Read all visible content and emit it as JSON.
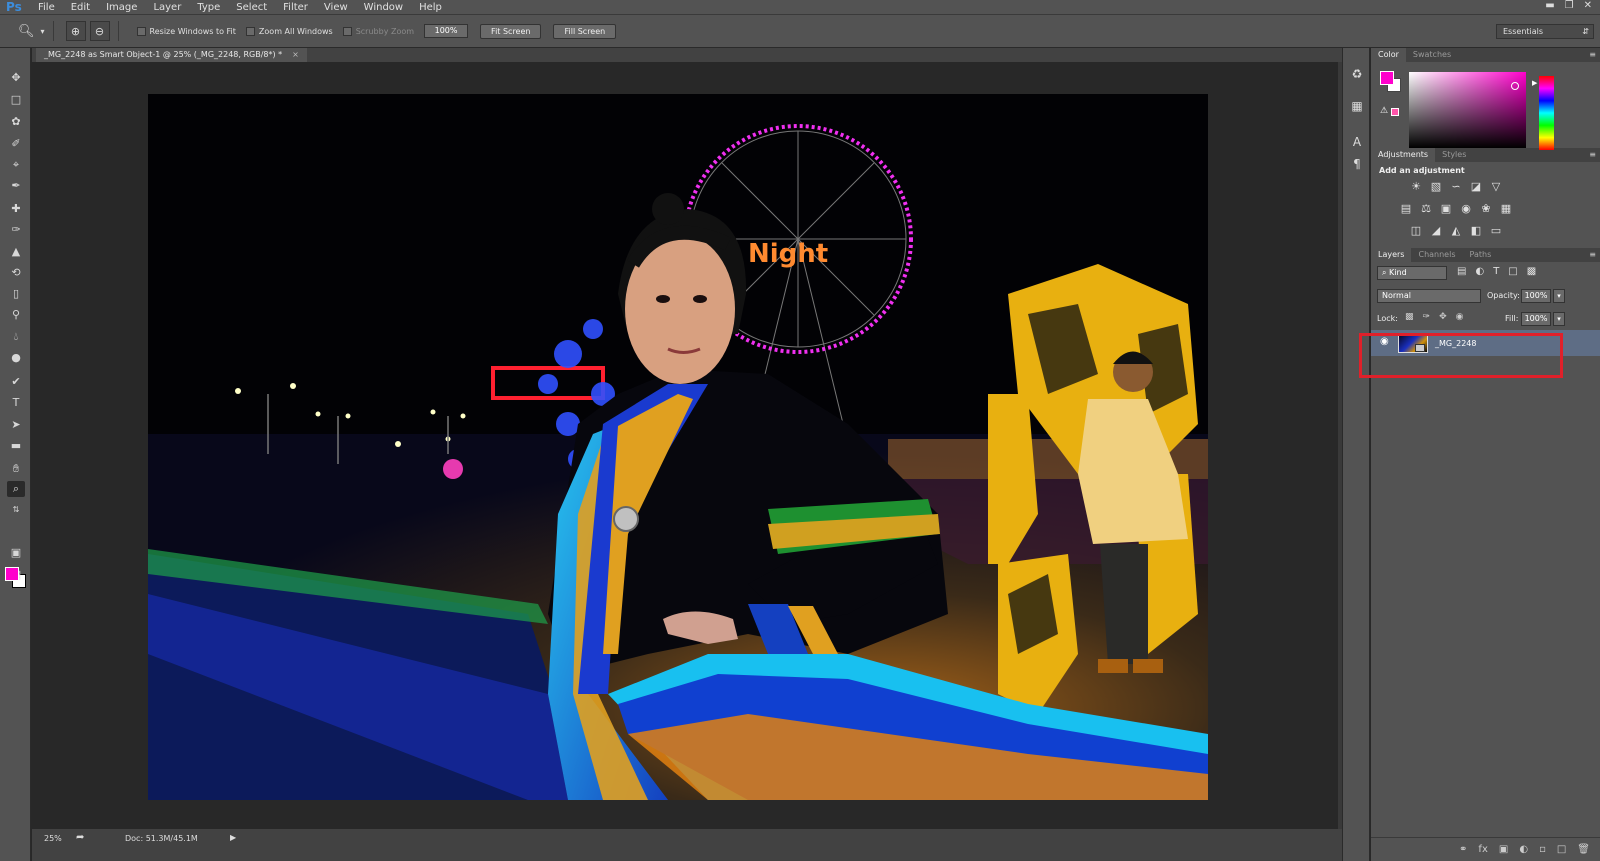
{
  "app": {
    "logo": "Ps"
  },
  "menu": [
    "File",
    "Edit",
    "Image",
    "Layer",
    "Type",
    "Select",
    "Filter",
    "View",
    "Window",
    "Help"
  ],
  "window_controls": [
    "▬",
    "❐",
    "✕"
  ],
  "options_bar": {
    "resize_windows_label": "Resize Windows to Fit",
    "zoom_all_label": "Zoom All Windows",
    "scrubby_zoom_label": "Scrubby Zoom",
    "zoom_value": "100%",
    "fit_screen_label": "Fit Screen",
    "fill_screen_label": "Fill Screen",
    "workspace": "Essentials"
  },
  "document_tab": {
    "title": "_MG_2248 as Smart Object-1 @ 25% (_MG_2248, RGB/8*) *",
    "close": "×"
  },
  "status_bar": {
    "zoom": "25%",
    "doc_size": "Doc: 51.3M/45.1M"
  },
  "photo": {
    "sign_text": "Night"
  },
  "colors": {
    "foreground": "#ff00cc",
    "background": "#ffffff",
    "layer_selection": "#5e6d85",
    "highlight_box": "#e0202a"
  },
  "panels": {
    "color": {
      "tabs": [
        "Color",
        "Swatches"
      ]
    },
    "adjustments": {
      "tabs": [
        "Adjustments",
        "Styles"
      ],
      "title": "Add an adjustment"
    },
    "layers": {
      "tabs": [
        "Layers",
        "Channels",
        "Paths"
      ],
      "filter_kind": "Kind",
      "blend_mode": "Normal",
      "opacity_label": "Opacity:",
      "opacity": "100%",
      "lock_label": "Lock:",
      "fill_label": "Fill:",
      "fill": "100%",
      "items": [
        {
          "name": "_MG_2248",
          "visible": true,
          "smart_object": true,
          "selected": true
        }
      ]
    }
  },
  "tools": [
    "move-tool",
    "marquee-tool",
    "lasso-tool",
    "quick-select-tool",
    "crop-tool",
    "eyedropper-tool",
    "healing-brush-tool",
    "brush-tool",
    "clone-stamp-tool",
    "history-brush-tool",
    "eraser-tool",
    "paint-bucket-tool",
    "blur-tool",
    "dodge-tool",
    "pen-tool",
    "type-tool",
    "path-selection-tool",
    "rectangle-tool",
    "hand-tool",
    "zoom-tool"
  ]
}
